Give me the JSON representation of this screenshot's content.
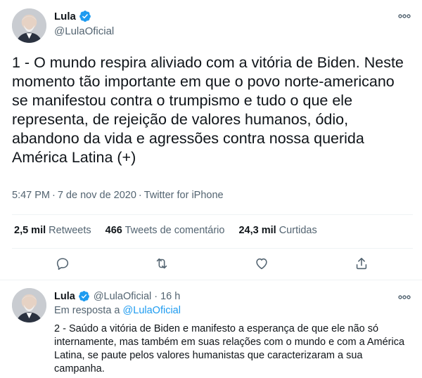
{
  "main_tweet": {
    "author_name": "Lula",
    "author_handle": "@LulaOficial",
    "text": "1 - O mundo respira aliviado com a vitória de Biden. Neste momento tão importante em que o povo norte-americano se manifestou contra o trumpismo e tudo o que ele representa, de rejeição de valores humanos, ódio, abandono da vida e agressões contra nossa querida América Latina (+)",
    "time": "5:47 PM",
    "date": "7 de nov de 2020",
    "source": "Twitter for iPhone",
    "stats": {
      "retweets_count": "2,5 mil",
      "retweets_label": "Retweets",
      "comments_count": "466",
      "comments_label": "Tweets de comentário",
      "likes_count": "24,3 mil",
      "likes_label": "Curtidas"
    }
  },
  "reply_tweet": {
    "author_name": "Lula",
    "author_handle": "@LulaOficial",
    "age": "16 h",
    "in_reply_prefix": "Em resposta a",
    "in_reply_handle": "@LulaOficial",
    "text": "2 - Saúdo a vitória de Biden e manifesto a esperança de que ele não só internamente, mas também em suas relações com o mundo e com a América Latina, se paute pelos valores humanistas que caracterizaram a sua campanha."
  },
  "icons": {
    "verified": "verified-badge-icon",
    "more": "more-options-icon",
    "reply": "reply-icon",
    "retweet": "retweet-icon",
    "like": "like-icon",
    "share": "share-icon"
  },
  "colors": {
    "accent": "#1d9bf0",
    "secondary_text": "#536471",
    "divider": "#eff3f4"
  }
}
